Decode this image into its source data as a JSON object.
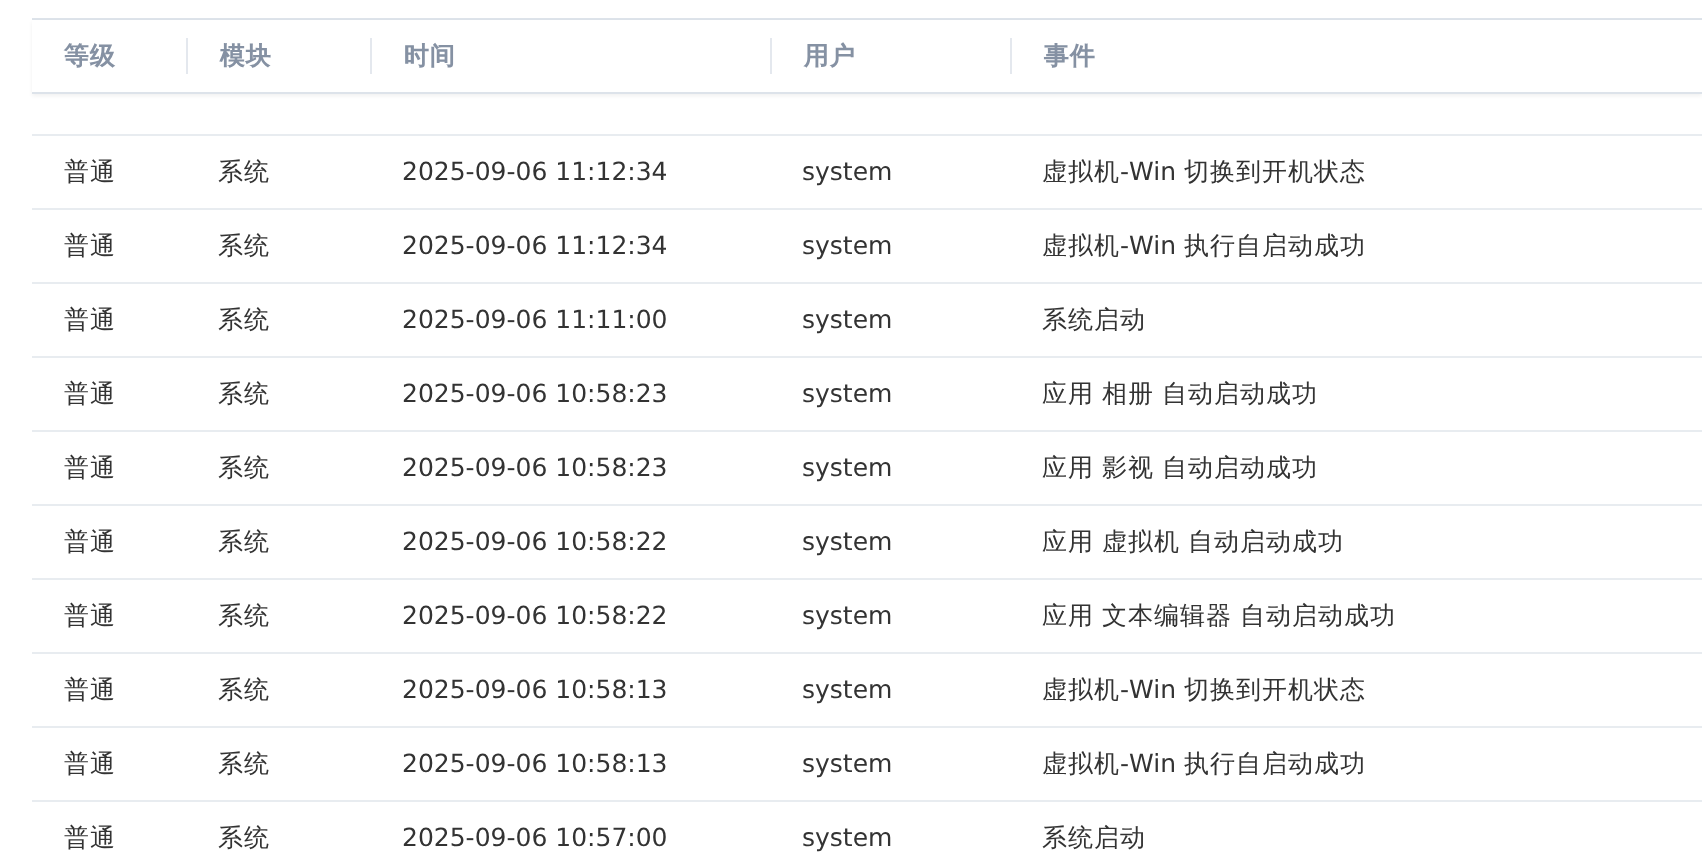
{
  "table": {
    "columns": [
      "等级",
      "模块",
      "时间",
      "用户",
      "事件"
    ],
    "rows": [
      {
        "cells": [
          "普通",
          "系统",
          "2025-09-06 11:12:34",
          "system",
          "虚拟机-Win 切换到开机状态"
        ]
      },
      {
        "cells": [
          "普通",
          "系统",
          "2025-09-06 11:12:34",
          "system",
          "虚拟机-Win 执行自启动成功"
        ]
      },
      {
        "cells": [
          "普通",
          "系统",
          "2025-09-06 11:11:00",
          "system",
          "系统启动"
        ]
      },
      {
        "cells": [
          "普通",
          "系统",
          "2025-09-06 10:58:23",
          "system",
          "应用 相册 自动启动成功"
        ]
      },
      {
        "cells": [
          "普通",
          "系统",
          "2025-09-06 10:58:23",
          "system",
          "应用 影视 自动启动成功"
        ]
      },
      {
        "cells": [
          "普通",
          "系统",
          "2025-09-06 10:58:22",
          "system",
          "应用 虚拟机 自动启动成功"
        ]
      },
      {
        "cells": [
          "普通",
          "系统",
          "2025-09-06 10:58:22",
          "system",
          "应用 文本编辑器 自动启动成功"
        ]
      },
      {
        "cells": [
          "普通",
          "系统",
          "2025-09-06 10:58:13",
          "system",
          "虚拟机-Win 切换到开机状态"
        ]
      },
      {
        "cells": [
          "普通",
          "系统",
          "2025-09-06 10:58:13",
          "system",
          "虚拟机-Win 执行自启动成功"
        ]
      },
      {
        "cells": [
          "普通",
          "系统",
          "2025-09-06 10:57:00",
          "system",
          "系统启动"
        ]
      }
    ]
  }
}
